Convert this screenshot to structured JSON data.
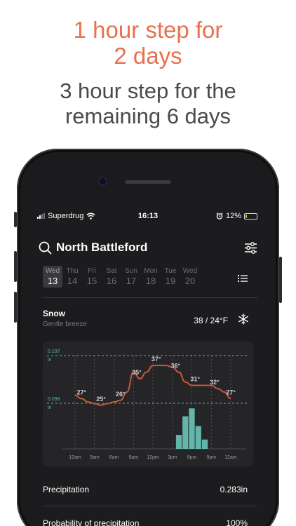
{
  "promo": {
    "line1a": "1 hour step for",
    "line1b": "2 days",
    "line2a": "3 hour step for the",
    "line2b": "remaining 6 days"
  },
  "status": {
    "carrier": "Superdrug",
    "time": "16:13",
    "battery_text": "12%",
    "battery_level": 0.12
  },
  "header": {
    "city": "North Battleford"
  },
  "days": [
    {
      "name": "Wed",
      "date": "13",
      "active": true
    },
    {
      "name": "Thu",
      "date": "14"
    },
    {
      "name": "Fri",
      "date": "15"
    },
    {
      "name": "Sat",
      "date": "16"
    },
    {
      "name": "Sun",
      "date": "17"
    },
    {
      "name": "Mon",
      "date": "18"
    },
    {
      "name": "Tue",
      "date": "19"
    },
    {
      "name": "Wed",
      "date": "20"
    }
  ],
  "condition": {
    "title": "Snow",
    "subtitle": "Gentle breeze",
    "temp_range": "38 / 24°F"
  },
  "chart_data": {
    "type": "line",
    "x_ticks": [
      "12am",
      "3am",
      "6am",
      "9am",
      "12pm",
      "3pm",
      "6pm",
      "9pm",
      "12am"
    ],
    "precip_ref": [
      {
        "label": "0.197",
        "unit": "in",
        "value": 0.197
      },
      {
        "label": "0.098",
        "unit": "in",
        "value": 0.098
      }
    ],
    "temperature": {
      "x": [
        0,
        1,
        2,
        3,
        4,
        5,
        6,
        7,
        8,
        9,
        10,
        11,
        12,
        13,
        14,
        15,
        16,
        17,
        18,
        19,
        20,
        21,
        22,
        23,
        24
      ],
      "y": [
        28,
        27,
        26,
        25.5,
        25,
        25.5,
        26,
        26.5,
        29,
        35,
        33,
        35,
        37,
        37,
        37,
        36.5,
        35,
        32,
        31,
        31,
        31,
        31,
        30,
        29,
        27
      ],
      "labels": [
        {
          "x": 1,
          "text": "27°"
        },
        {
          "x": 4,
          "text": "25°"
        },
        {
          "x": 7,
          "text": "26°"
        },
        {
          "x": 9.5,
          "text": "35°"
        },
        {
          "x": 12.5,
          "text": "37°"
        },
        {
          "x": 15.5,
          "text": "36°"
        },
        {
          "x": 18.5,
          "text": "31°"
        },
        {
          "x": 21.5,
          "text": "32°"
        },
        {
          "x": 24,
          "text": "27°"
        }
      ],
      "ylim": [
        22,
        40
      ]
    },
    "precipitation": {
      "x": [
        16,
        17,
        18,
        19,
        20
      ],
      "values": [
        0.03,
        0.07,
        0.087,
        0.049,
        0.02
      ],
      "ylim": [
        0,
        0.197
      ]
    },
    "colors": {
      "temperature": "#c35a3c",
      "precipitation": "#6fcfc0",
      "reference": "#4fb9a4"
    }
  },
  "stats": [
    {
      "label": "Precipitation",
      "value": "0.283in"
    },
    {
      "label": "Probability of precipitation",
      "value": "100%"
    }
  ]
}
